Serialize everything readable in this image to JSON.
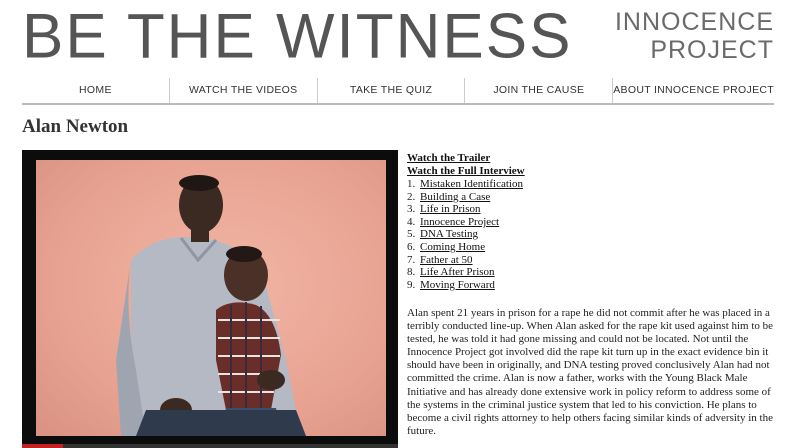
{
  "site": {
    "logo_text": "BE THE WITNESS",
    "brand_line1": "INNOCENCE",
    "brand_line2": "PROJECT"
  },
  "nav": {
    "items": [
      {
        "label": "HOME"
      },
      {
        "label": "WATCH THE VIDEOS"
      },
      {
        "label": "TAKE THE QUIZ"
      },
      {
        "label": "JOIN THE CAUSE"
      },
      {
        "label": "ABOUT INNOCENCE PROJECT"
      }
    ]
  },
  "page": {
    "title": "Alan Newton"
  },
  "video": {
    "progress": 0.11,
    "accent_color": "#c32222"
  },
  "links": {
    "trailer": "Watch the Trailer",
    "full_interview": "Watch the Full Interview",
    "chapters": [
      {
        "num": "1.",
        "label": "Mistaken Identification"
      },
      {
        "num": "2.",
        "label": "Building a Case"
      },
      {
        "num": "3.",
        "label": "Life in Prison"
      },
      {
        "num": "4.",
        "label": "Innocence Project"
      },
      {
        "num": "5.",
        "label": "DNA Testing"
      },
      {
        "num": "6.",
        "label": "Coming Home"
      },
      {
        "num": "7.",
        "label": "Father at 50"
      },
      {
        "num": "8.",
        "label": "Life After Prison"
      },
      {
        "num": "9.",
        "label": "Moving Forward"
      }
    ]
  },
  "description": "Alan spent 21 years in prison for a rape he did not commit after he was placed in a terribly conducted line-up. When Alan asked for the rape kit used against him to be tested, he was told it had gone missing and could not be located. Not until the Innocence Project got involved did the rape kit turn up in the exact evidence bin it should have been in originally, and DNA testing proved conclusively Alan had not committed the crime. Alan is now a father, works with the Young Black Male Initiative and has already done extensive work in policy reform to address some of the systems in the criminal justice system that led to his conviction. He plans to become a civil rights attorney to help others facing similar kinds of adversity in the future."
}
